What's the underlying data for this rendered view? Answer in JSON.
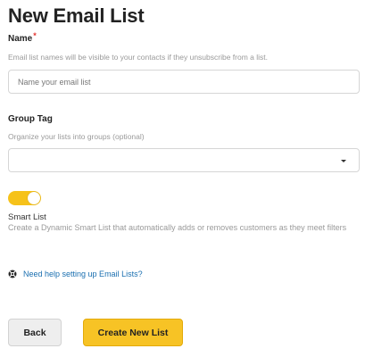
{
  "page": {
    "title": "New Email List"
  },
  "name_field": {
    "label": "Name",
    "required_marker": "*",
    "help": "Email list names will be visible to your contacts if they unsubscribe from a list.",
    "placeholder": "Name your email list",
    "value": ""
  },
  "group_tag": {
    "label": "Group Tag",
    "help": "Organize your lists into groups (optional)",
    "selected": ""
  },
  "smart_list": {
    "toggle_on": true,
    "label": "Smart List",
    "help": "Create a Dynamic Smart List that automatically adds or removes customers as they meet filters"
  },
  "help_link": {
    "icon": "lifebuoy-icon",
    "text": "Need help setting up Email Lists?"
  },
  "buttons": {
    "back": "Back",
    "create": "Create New List"
  },
  "colors": {
    "accent": "#f7c325",
    "link": "#1a6fb0",
    "required": "#e3342f"
  }
}
